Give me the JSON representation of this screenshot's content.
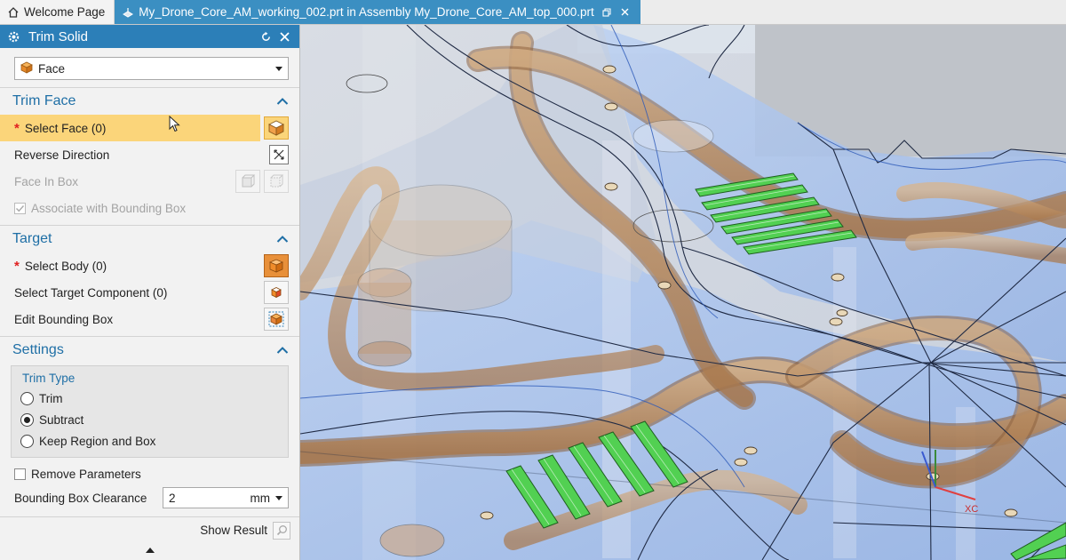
{
  "tabs": [
    {
      "label": "Welcome Page",
      "icon": "home-icon",
      "active": false
    },
    {
      "label": "My_Drone_Core_AM_working_002.prt in Assembly My_Drone_Core_AM_top_000.prt",
      "icon": "part-icon",
      "active": true
    }
  ],
  "dialog": {
    "title": "Trim Solid",
    "type_value": "Face",
    "trim_face": {
      "heading": "Trim Face",
      "select_face": "Select Face (0)",
      "reverse_direction": "Reverse Direction",
      "face_in_box": "Face In Box",
      "associate_bbox": "Associate with Bounding Box"
    },
    "target": {
      "heading": "Target",
      "select_body": "Select Body (0)",
      "select_target_component": "Select Target Component (0)",
      "edit_bounding_box": "Edit Bounding Box"
    },
    "settings": {
      "heading": "Settings",
      "trim_type_title": "Trim Type",
      "options": [
        "Trim",
        "Subtract",
        "Keep Region and Box"
      ],
      "selected_option": "Subtract",
      "remove_parameters": "Remove Parameters",
      "bbox_clearance_label": "Bounding Box Clearance",
      "bbox_clearance_value": "2",
      "bbox_clearance_unit": "mm"
    },
    "show_result": "Show Result"
  },
  "viewport": {
    "axis_label": "XC",
    "colors": {
      "background": "#cfd7e3",
      "glass": "#a9c3ec",
      "channel": "#c49a6c",
      "highlight": "#4fd04f",
      "edge": "#1f2a44"
    }
  }
}
